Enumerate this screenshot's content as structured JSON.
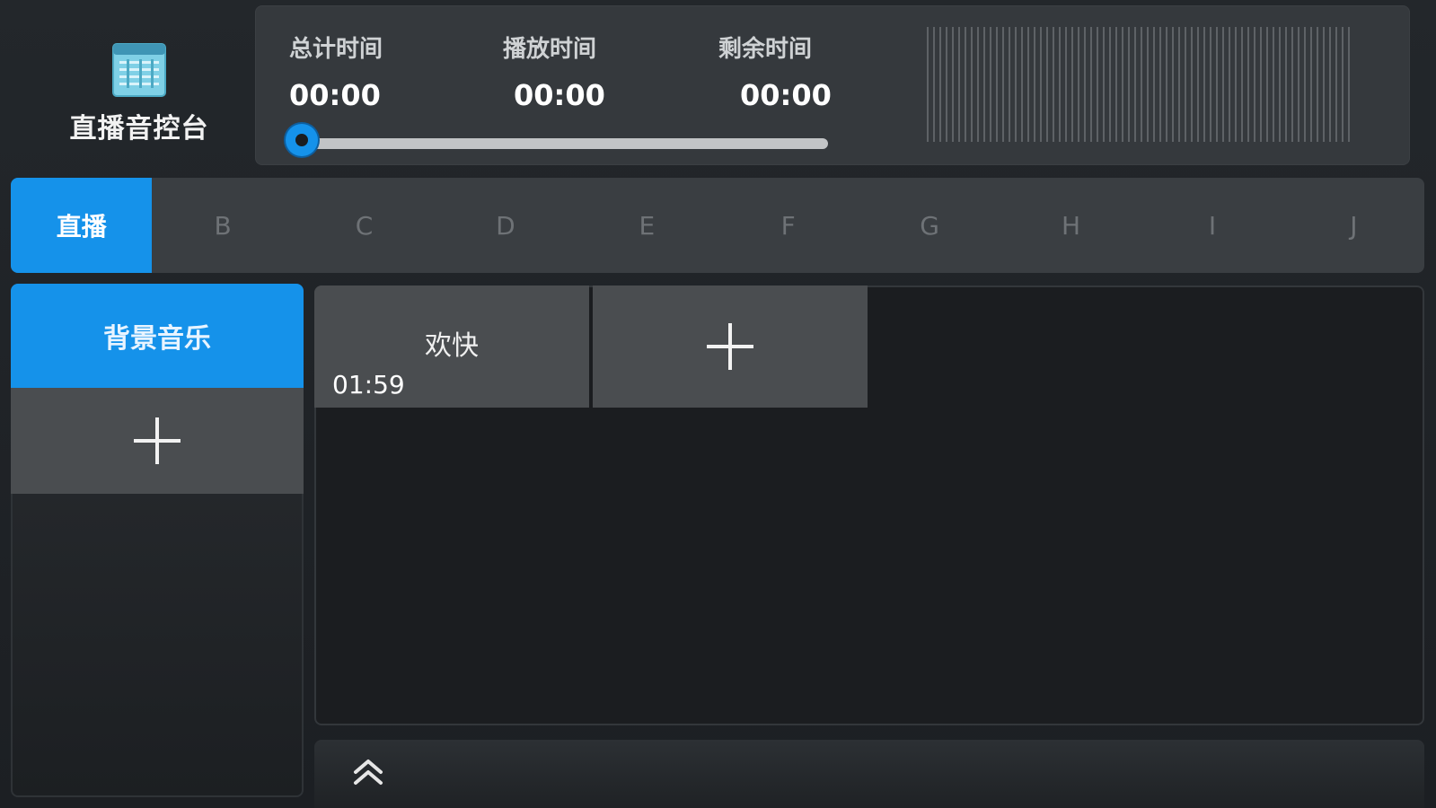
{
  "app": {
    "title": "直播音控台",
    "logo_icon": "mixer-window-icon"
  },
  "time_panel": {
    "total": {
      "label": "总计时间",
      "value": "00:00"
    },
    "played": {
      "label": "播放时间",
      "value": "00:00"
    },
    "remaining": {
      "label": "剩余时间",
      "value": "00:00"
    },
    "progress": 0,
    "accent_color": "#1592ea"
  },
  "tabs": [
    {
      "label": "直播",
      "active": true
    },
    {
      "label": "B",
      "active": false
    },
    {
      "label": "C",
      "active": false
    },
    {
      "label": "D",
      "active": false
    },
    {
      "label": "E",
      "active": false
    },
    {
      "label": "F",
      "active": false
    },
    {
      "label": "G",
      "active": false
    },
    {
      "label": "H",
      "active": false
    },
    {
      "label": "I",
      "active": false
    },
    {
      "label": "J",
      "active": false
    }
  ],
  "categories": [
    {
      "label": "背景音乐",
      "selected": true
    }
  ],
  "clips": [
    {
      "name": "欢快",
      "duration": "01:59"
    }
  ],
  "icons": {
    "add": "plus-icon",
    "expand": "double-chevron-up-icon"
  },
  "colors": {
    "accent": "#1592ea",
    "cell": "#4a4d50",
    "panel": "#35393d",
    "tab_bar": "#3a3e42"
  }
}
